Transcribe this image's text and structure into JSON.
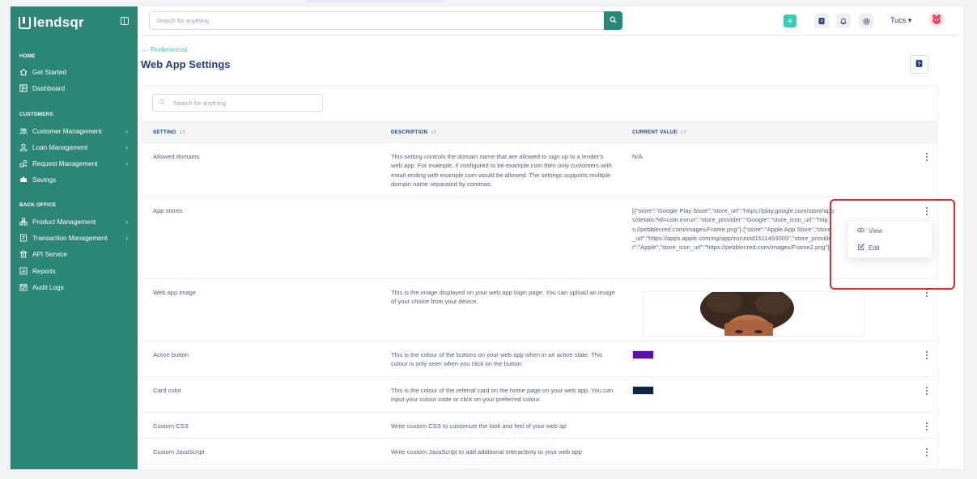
{
  "brand": {
    "name": "lendsqr"
  },
  "sidebar": {
    "sections": [
      {
        "title": "HOME",
        "items": [
          {
            "label": "Get Started",
            "icon": "home-icon",
            "chevron": false
          },
          {
            "label": "Dashboard",
            "icon": "dashboard-icon",
            "chevron": false
          }
        ]
      },
      {
        "title": "CUSTOMERS",
        "items": [
          {
            "label": "Customer Management",
            "icon": "users-icon",
            "chevron": true
          },
          {
            "label": "Loan Management",
            "icon": "loan-icon",
            "chevron": true
          },
          {
            "label": "Request Management",
            "icon": "request-icon",
            "chevron": true
          },
          {
            "label": "Savings",
            "icon": "savings-icon",
            "chevron": false
          }
        ]
      },
      {
        "title": "BACK OFFICE",
        "items": [
          {
            "label": "Product Management",
            "icon": "product-icon",
            "chevron": true
          },
          {
            "label": "Transaction Management",
            "icon": "transaction-icon",
            "chevron": true
          },
          {
            "label": "API Service",
            "icon": "api-icon",
            "chevron": false
          },
          {
            "label": "Reports",
            "icon": "reports-icon",
            "chevron": false
          },
          {
            "label": "Audit Logs",
            "icon": "audit-icon",
            "chevron": false
          }
        ]
      }
    ]
  },
  "topbar": {
    "search_placeholder": "Search for anything",
    "user_name": "Tucs",
    "user_caret": "▾"
  },
  "page": {
    "breadcrumb": "Preferences",
    "breadcrumb_arrow": "←",
    "title": "Web App Settings"
  },
  "table": {
    "search_placeholder": "Search for anything",
    "headers": [
      "SETTING",
      "DESCRIPTION",
      "CURRENT VALUE"
    ],
    "sort_glyph": "↓↑",
    "rows": [
      {
        "setting": "Allowed domains",
        "description": "This setting controls the domain name that are allowed to sign up to a lender's web app. For example, if configured to be example.com then only customers with email ending with example.com would be allowed. The settings supports multiple domain name separated by commas.",
        "value": "N/A"
      },
      {
        "setting": "App stores",
        "description": "",
        "value": "[{\"store\":\"Google Play Store\",\"store_url\":\"https://play.google.com/store/apps/details?id=com.irorun\",\"store_provider\":\"Google\",\"store_icon_url\":\"https://pebblecred.com/images/Frame.png\"},{\"store\":\"Apple App Store\",\"store_url\":\"https://apps.apple.com/ng/app/irorun/id1511493009\",\"store_provider\":\"Apple\",\"store_icon_url\":\"https://pebblecred.com/images/Frame2.png\"}]"
      },
      {
        "setting": "Web app image",
        "description": "This is the image displayed on your web app login page. You can upload an image of your choice from your device.",
        "value": ""
      },
      {
        "setting": "Active button",
        "description": "This is the colour of the buttons on your web app when in an active state. This colour is only seen when you click on the button.",
        "value": "",
        "swatch": "#5a0fa8"
      },
      {
        "setting": "Card color",
        "description": "This is the colour of the referral card on the home page on your web app. You can input your colour code or click on your preferred colour.",
        "value": "",
        "swatch": "#0f2541"
      },
      {
        "setting": "Custom CSS",
        "description": "Write custom CSS to customize the look and feel of your web ap",
        "value": ""
      },
      {
        "setting": "Custom JavaScript",
        "description": "Write custom JavaScript to add additional interactivity to your web app",
        "value": ""
      }
    ]
  },
  "dropdown": {
    "view_label": "View",
    "edit_label": "Edit"
  },
  "colors": {
    "sidebar": "#2c8676",
    "accent": "#39cdb5",
    "primary_text": "#213f7d",
    "highlight": "#d32f2f"
  }
}
